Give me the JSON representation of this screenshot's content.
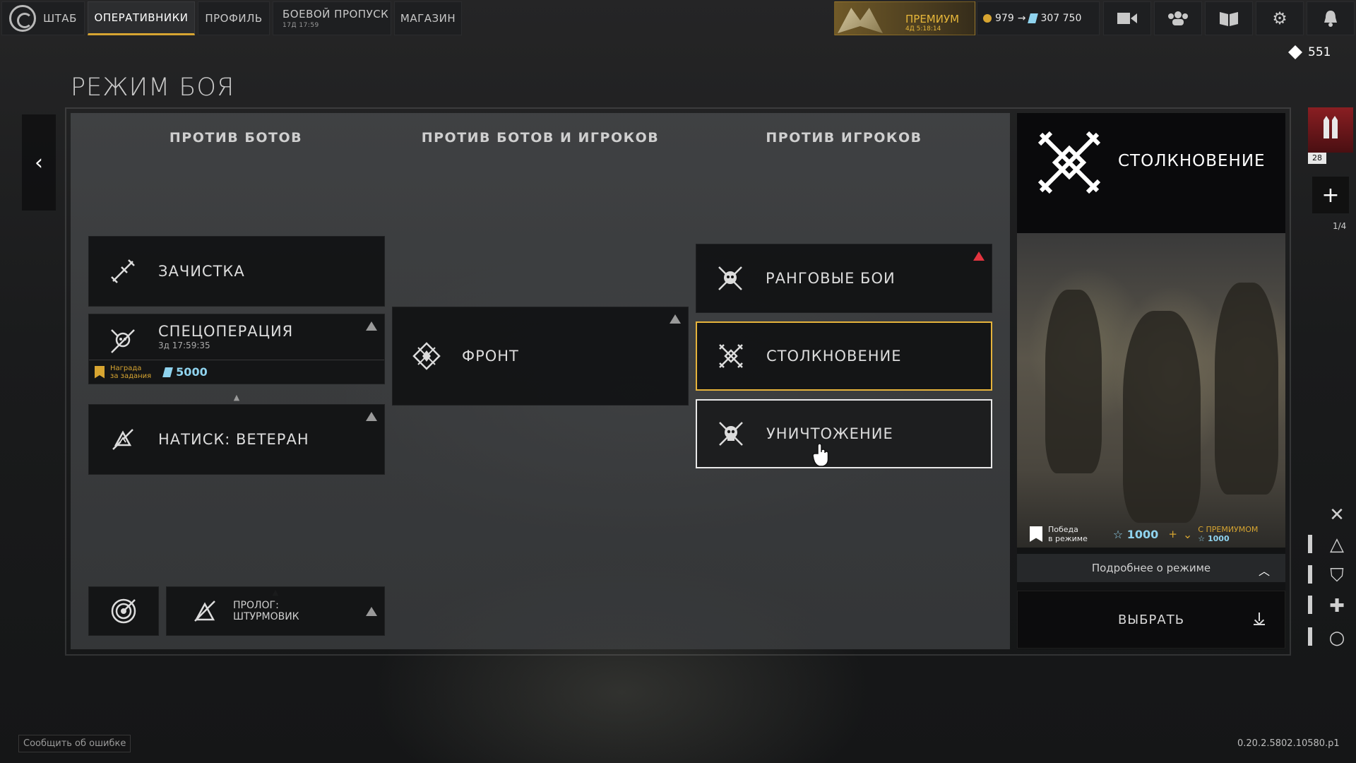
{
  "topbar": {
    "home_label": "ШТАБ",
    "tabs": [
      {
        "label": "ОПЕРАТИВНИКИ"
      },
      {
        "label": "ПРОФИЛЬ"
      },
      {
        "label": "БОЕВОЙ ПРОПУСК",
        "sub": "17Д 17:59"
      },
      {
        "label": "МАГАЗИН"
      }
    ],
    "premium": {
      "label": "ПРЕМИУМ",
      "timer": "4Д 5:18:14"
    },
    "currency": {
      "coins": "979",
      "arrow": "→",
      "crystals": "307 750"
    },
    "icons": [
      "video-icon",
      "friends-icon",
      "codex-icon",
      "settings-icon",
      "notifications-icon"
    ]
  },
  "tokens": "551",
  "page_title": "РЕЖИМ БОЯ",
  "columns": {
    "bots": "ПРОТИВ БОТОВ",
    "mixed": "ПРОТИВ БОТОВ И ИГРОКОВ",
    "players": "ПРОТИВ ИГРОКОВ"
  },
  "modes": {
    "cleanup": "ЗАЧИСТКА",
    "specop": {
      "label": "СПЕЦОПЕРАЦИЯ",
      "timer": "3д 17:59:35",
      "reward_label_1": "Награда",
      "reward_label_2": "за задания",
      "reward_value": "5000"
    },
    "onslaught": "НАТИСК: ВЕТЕРАН",
    "prologue_1": "ПРОЛОГ:",
    "prologue_2": "ШТУРМОВИК",
    "front": "ФРОНТ",
    "ranked": "РАНГОВЫЕ БОИ",
    "clash": "СТОЛКНОВЕНИЕ",
    "annihilation": "УНИЧТОЖЕНИЕ"
  },
  "side_panel": {
    "title": "СТОЛКНОВЕНИЕ",
    "win_label_1": "Победа",
    "win_label_2": "в режиме",
    "win_value": "1000",
    "plus": "+",
    "premium_label": "С ПРЕМИУМОМ",
    "premium_value": "1000",
    "more": "Подробнее о режиме",
    "select": "ВЫБРАТЬ"
  },
  "squad": {
    "level": "28",
    "count": "1/4"
  },
  "footer": {
    "bug_report": "Сообщить об ошибке",
    "version": "0.20.2.5802.10580.p1"
  },
  "colors": {
    "accent_gold": "#e6b33b",
    "crystal_blue": "#8fd3ee",
    "warning_red": "#e3343f"
  }
}
